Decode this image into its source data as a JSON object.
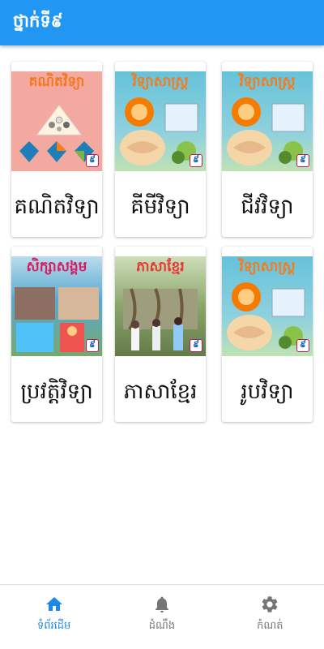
{
  "appbar": {
    "title": "ថ្នាក់ទី៩"
  },
  "books": [
    {
      "label": "គណិតវិទ្យា",
      "cover_title": "គណិតវិទ្យា",
      "cover_bg": "#f4a9a0",
      "title_color": "#f2791f",
      "grade": "៩"
    },
    {
      "label": "គីមីវិទ្យា",
      "cover_title": "វិទ្យាសាស្ត្រ",
      "cover_bg": "#63c1d6",
      "title_color": "#f27c1f",
      "grade": "៩"
    },
    {
      "label": "ជីវវិទ្យា",
      "cover_title": "វិទ្យាសាស្ត្រ",
      "cover_bg": "#63c1d6",
      "title_color": "#f27c1f",
      "grade": "៩"
    },
    {
      "label": "ប្រវត្តិវិទ្យា",
      "cover_title": "សិក្សាសង្គម",
      "cover_bg": "#5aa8cf",
      "title_color": "#d81b60",
      "grade": "៩"
    },
    {
      "label": "ភាសាខ្មែរ",
      "cover_title": "ភាសាខ្មែរ",
      "cover_bg": "#6f8f55",
      "title_color": "#e53935",
      "grade": "៩"
    },
    {
      "label": "រូបវិទ្យា",
      "cover_title": "វិទ្យាសាស្ត្រ",
      "cover_bg": "#63c1d6",
      "title_color": "#f27c1f",
      "grade": "៩"
    }
  ],
  "nav": [
    {
      "label": "ទំព័រដើម",
      "icon": "home-icon",
      "active": true
    },
    {
      "label": "ដំណឹង",
      "icon": "bell-icon",
      "active": false
    },
    {
      "label": "កំណត់",
      "icon": "gear-icon",
      "active": false
    }
  ],
  "colors": {
    "primary": "#2196f3",
    "nav_active": "#1e88e5",
    "nav_inactive": "#757575"
  }
}
